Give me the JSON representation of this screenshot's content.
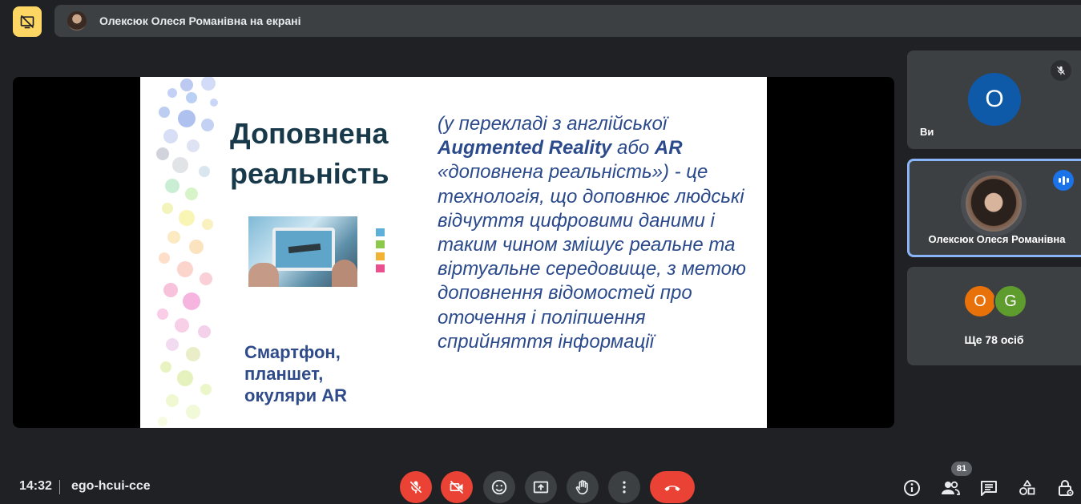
{
  "top_bar": {
    "presenter_text": "Олексюк Олеся Романівна на екрані"
  },
  "slide": {
    "title": "Доповнена реальність",
    "devices": "Смартфон, планшет, окуляри AR",
    "body_prefix": "(у перекладі з англійської ",
    "body_bold_1": "Augmented Reality",
    "body_mid": " або ",
    "body_bold_2": "AR",
    "body_rest": " «доповнена реальність») - це технологія, що доповнює людські відчуття цифровими даними і таким чином змішує реальне та віртуальне середовище,  з метою доповнення відомостей про оточення і поліпшення сприйняття інформації",
    "swatch_colors": [
      "#5fb0d8",
      "#8cc84b",
      "#f2b233",
      "#ea4f8e"
    ]
  },
  "participants": {
    "you": {
      "initial": "О",
      "label": "Ви",
      "color": "#0f5aa8"
    },
    "speaker": {
      "label": "Олексюк Олеся Романівна"
    },
    "more": {
      "initial_a": "O",
      "initial_b": "G",
      "label": "Ще 78 осіб"
    }
  },
  "bottom_bar": {
    "time": "14:32",
    "meeting_code": "ego-hcui-cce",
    "participant_count": "81"
  },
  "colors": {
    "background": "#202124",
    "panel": "#3c4043",
    "danger": "#ea4335",
    "accent": "#8ab4f8",
    "pin": "#fdd663"
  },
  "icons": [
    "pin-off-icon",
    "mic-off-icon",
    "camera-off-icon",
    "emoji-icon",
    "present-icon",
    "hand-icon",
    "more-vert-icon",
    "call-end-icon",
    "info-icon",
    "people-icon",
    "chat-icon",
    "activities-icon",
    "host-controls-icon"
  ]
}
